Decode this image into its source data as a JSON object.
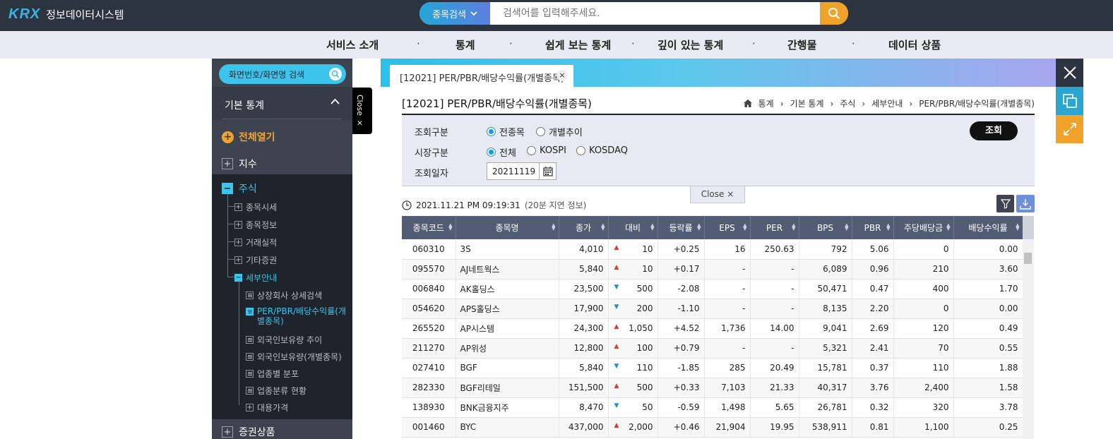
{
  "header": {
    "logo_mark": "KRX",
    "logo_text": "정보데이터시스템",
    "search_category": "종목검색",
    "search_placeholder": "검색어를 입력해주세요."
  },
  "gnb": [
    "서비스 소개",
    "통계",
    "쉽게 보는 통계",
    "깊이 있는 통계",
    "간행물",
    "데이터 상품"
  ],
  "sidebar": {
    "search_label": "화면번호/화면명 검색",
    "basic_title": "기본 통계",
    "open_all": "전체열기",
    "index": "지수",
    "stock": "주식",
    "stock_items": [
      "종목시세",
      "종목정보",
      "거래실적",
      "기타증권"
    ],
    "detail": "세부안내",
    "detail_items": [
      "상장회사 상세검색",
      "PER/PBR/배당수익률(개별종목)",
      "외국인보유량 추이",
      "외국인보유량(개별종목)",
      "업종별 분포",
      "업종분류 현황",
      "대용가격"
    ],
    "securities": "증권상품",
    "close_tab": "Close ×"
  },
  "tab": {
    "label": "[12021] PER/PBR/배당수익률(개별종목)",
    "close": "×"
  },
  "page": {
    "title": "[12021] PER/PBR/배당수익률(개별종목)",
    "breadcrumb": [
      "통계",
      "기본 통계",
      "주식",
      "세부안내",
      "PER/PBR/배당수익률(개별종목)"
    ]
  },
  "conditions": {
    "inquiry_type_label": "조회구분",
    "inquiry_all": "전종목",
    "inquiry_trend": "개별추이",
    "market_label": "시장구분",
    "market_all": "전체",
    "market_kospi": "KOSPI",
    "market_kosdaq": "KOSDAQ",
    "date_label": "조회일자",
    "date_value": "20211119",
    "query_button": "조회",
    "close_label": "Close"
  },
  "timestamp": "2021.11.21 PM 09:19:31",
  "delay_note": "(20분 지연 정보)",
  "table": {
    "headers": [
      "종목코드",
      "종목명",
      "종가",
      "대비",
      "등락률",
      "EPS",
      "PER",
      "BPS",
      "PBR",
      "주당배당금",
      "배당수익률"
    ],
    "rows": [
      [
        "060310",
        "3S",
        "4,010",
        "up",
        "10",
        "+0.25",
        "16",
        "250.63",
        "792",
        "5.06",
        "0",
        "0.00"
      ],
      [
        "095570",
        "AJ네트웍스",
        "5,840",
        "up",
        "10",
        "+0.17",
        "-",
        "-",
        "6,089",
        "0.96",
        "210",
        "3.60"
      ],
      [
        "006840",
        "AK홀딩스",
        "23,500",
        "down",
        "500",
        "-2.08",
        "-",
        "-",
        "50,471",
        "0.47",
        "400",
        "1.70"
      ],
      [
        "054620",
        "APS홀딩스",
        "17,900",
        "down",
        "200",
        "-1.10",
        "-",
        "-",
        "8,135",
        "2.20",
        "0",
        "0.00"
      ],
      [
        "265520",
        "AP시스템",
        "24,300",
        "up",
        "1,050",
        "+4.52",
        "1,736",
        "14.00",
        "9,041",
        "2.69",
        "120",
        "0.49"
      ],
      [
        "211270",
        "AP위성",
        "12,800",
        "up",
        "100",
        "+0.79",
        "-",
        "-",
        "5,321",
        "2.41",
        "70",
        "0.55"
      ],
      [
        "027410",
        "BGF",
        "5,840",
        "down",
        "110",
        "-1.85",
        "285",
        "20.49",
        "15,781",
        "0.37",
        "110",
        "1.88"
      ],
      [
        "282330",
        "BGF리테일",
        "151,500",
        "up",
        "500",
        "+0.33",
        "7,103",
        "21.33",
        "40,317",
        "3.76",
        "2,400",
        "1.58"
      ],
      [
        "138930",
        "BNK금융지주",
        "8,470",
        "down",
        "50",
        "-0.59",
        "1,498",
        "5.65",
        "26,781",
        "0.32",
        "320",
        "3.78"
      ],
      [
        "001460",
        "BYC",
        "437,000",
        "up",
        "2,000",
        "+0.46",
        "21,904",
        "19.95",
        "538,911",
        "0.81",
        "1,100",
        "0.25"
      ]
    ]
  },
  "colors": {
    "accent": "#3cc4ea",
    "up": "#e2362b",
    "down": "#1d8ed8",
    "header_bg": "#2c3440",
    "orange": "#f0a22a"
  }
}
